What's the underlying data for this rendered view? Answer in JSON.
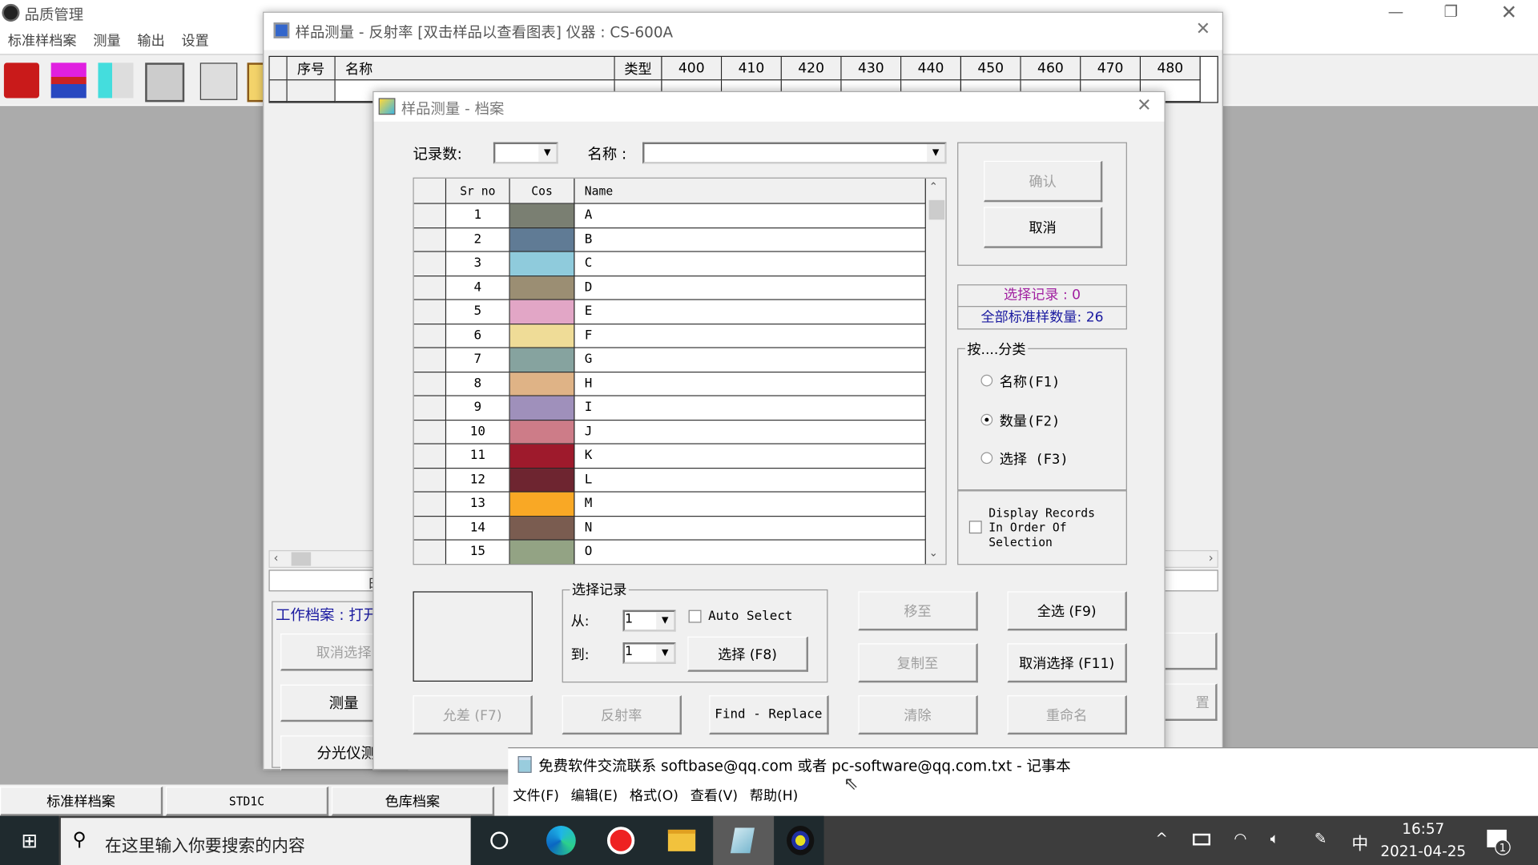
{
  "app": {
    "title": "品质管理",
    "menu": [
      "标准样档案",
      "测量",
      "输出",
      "设置"
    ],
    "toolbar": [
      "red-book-icon",
      "stacked-books-icon",
      "edit-notebook-icon",
      "form-report-icon",
      "devices-icon",
      "document-icon"
    ],
    "bottom_tabs": [
      "标准样档案",
      "STD1C",
      "色库档案"
    ]
  },
  "sample_window": {
    "title": "样品测量 - 反射率 [双击样品以查看图表]  仪器 : CS-600A",
    "columns": [
      "序号",
      "名称",
      "类型",
      "400",
      "410",
      "420",
      "430",
      "440",
      "450",
      "460",
      "470",
      "480"
    ],
    "status_partial": "白",
    "work_file": "工作档案 : 打开",
    "buttons": [
      "取消选择",
      "测量",
      "分光仪测量"
    ],
    "right_partial": "置"
  },
  "dialog": {
    "title": "样品测量 - 档案",
    "records_label": "记录数:",
    "records_value": "",
    "name_label": "名称 :",
    "name_value": "",
    "grid": {
      "headers": [
        "Sr no",
        "Cos",
        "Name"
      ],
      "rows": [
        {
          "no": "1",
          "color": "#7a7f72",
          "name": "A"
        },
        {
          "no": "2",
          "color": "#607b95",
          "name": "B"
        },
        {
          "no": "3",
          "color": "#8fcbdc",
          "name": "C"
        },
        {
          "no": "4",
          "color": "#9b8e73",
          "name": "D"
        },
        {
          "no": "5",
          "color": "#e2a6c6",
          "name": "E"
        },
        {
          "no": "6",
          "color": "#efdc97",
          "name": "F"
        },
        {
          "no": "7",
          "color": "#86a39f",
          "name": "G"
        },
        {
          "no": "8",
          "color": "#dfb386",
          "name": "H"
        },
        {
          "no": "9",
          "color": "#9f90bb",
          "name": "I"
        },
        {
          "no": "10",
          "color": "#cd7c88",
          "name": "J"
        },
        {
          "no": "11",
          "color": "#9e1a2c",
          "name": "K"
        },
        {
          "no": "12",
          "color": "#6e2530",
          "name": "L"
        },
        {
          "no": "13",
          "color": "#f9a825",
          "name": "M"
        },
        {
          "no": "14",
          "color": "#7a5c50",
          "name": "N"
        },
        {
          "no": "15",
          "color": "#93a384",
          "name": "O"
        }
      ]
    },
    "confirm": "确认",
    "cancel": "取消",
    "selected_records": "选择记录 : 0",
    "total_standards": "全部标准样数量: 26",
    "sort_group": "按....分类",
    "sort_options": [
      {
        "label": "名称(F1)",
        "checked": false
      },
      {
        "label": "数量(F2)",
        "checked": true
      },
      {
        "label": "选择 (F3)",
        "checked": false
      }
    ],
    "display_order": "Display Records In Order Of Selection",
    "display_order_checked": false,
    "select_group": "选择记录",
    "from_label": "从:",
    "from_value": "1",
    "to_label": "到:",
    "to_value": "1",
    "auto_select": "Auto Select",
    "auto_select_checked": false,
    "select_btn": "选择 (F8)",
    "move_to": "移至",
    "copy_to": "复制至",
    "select_all": "全选 (F9)",
    "deselect": "取消选择 (F11)",
    "tolerance": "允差 (F7)",
    "reflectance": "反射率",
    "find_replace": "Find - Replace",
    "clear": "清除",
    "rename": "重命名"
  },
  "notepad": {
    "title": "免费软件交流联系 softbase@qq.com 或者 pc-software@qq.com.txt - 记事本",
    "menu": [
      "文件(F)",
      "编辑(E)",
      "格式(O)",
      "查看(V)",
      "帮助(H)"
    ]
  },
  "taskbar": {
    "search_placeholder": "在这里输入你要搜索的内容",
    "time": "16:57",
    "date": "2021-04-25",
    "ime": "中",
    "notifications": "1"
  }
}
